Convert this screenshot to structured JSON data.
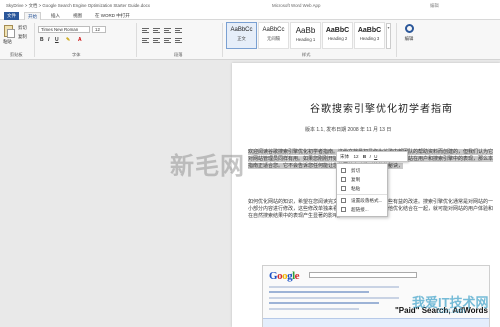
{
  "titlebar": {
    "breadcrumb": "SkyDrive > 文档 > Google Search Engine Optimization Starter Guide.docx",
    "app_title": "Microsoft Word Web App",
    "edit_flag": "编辑"
  },
  "tabs": [
    {
      "label": "文件"
    },
    {
      "label": "开始"
    },
    {
      "label": "插入"
    },
    {
      "label": "视图"
    },
    {
      "label": "在 WORD 中打开"
    }
  ],
  "ribbon": {
    "clipboard": {
      "paste": "粘贴",
      "cut": "剪切",
      "copy": "复制",
      "group_label": "剪贴板"
    },
    "font": {
      "name": "Times New Roman",
      "size": "12",
      "group_label": "字体",
      "bold": "B",
      "italic": "I",
      "underline": "U"
    },
    "paragraph": {
      "group_label": "段落"
    },
    "styles": {
      "group_label": "样式",
      "items": [
        {
          "sample": "AaBbCc",
          "name": "正文"
        },
        {
          "sample": "AaBbCc",
          "name": "无间隔"
        },
        {
          "sample": "AaBb",
          "name": "Heading 1"
        },
        {
          "sample": "AaBbC",
          "name": "Heading 2"
        },
        {
          "sample": "AaBbC",
          "name": "Heading 3"
        }
      ]
    },
    "editing": {
      "label": "编辑"
    }
  },
  "document": {
    "title": "谷歌搜索引擎优化初学者指南",
    "meta": "版本 1.1, 发布日期 2008 年 11 月 13 日",
    "paragraph1": "欢迎阅读谷歌搜索引擎优化初学者指南。这份文档最初是作为谷歌内部团队的帮助资料而创建的，但我们认为它对网站管理员同样有用。如果您刚刚开始接触搜索引擎优化，希望提升网站在用户和搜索引擎中的表现，那么本指南正适合您。它不会告诉您任何能让您的网站自动排到首位的秘诀，",
    "paragraph2": "如何优化网站的知识，希望在您阅读完文档之后能对网站进行一些有益的改进。搜索引擎优化通常是对网站的一小部分内容进行修改，这些修改单独来看似乎并不起眼，但与其他优化结合在一起，就可能对网站的用户体验和在自然搜索结果中的表现产生显著的影响。"
  },
  "minibar": {
    "font": "宋体",
    "size": "12",
    "bold": "B",
    "italic": "I",
    "underline": "U"
  },
  "context_menu": {
    "items": [
      {
        "label": "剪切"
      },
      {
        "label": "复制"
      },
      {
        "label": "粘贴"
      },
      {
        "label": "设置段落格式..."
      },
      {
        "label": "超链接..."
      }
    ]
  },
  "figure": {
    "logo_letters": [
      "G",
      "o",
      "o",
      "g",
      "l",
      "e"
    ],
    "caption": "\"Paid\" Search, AdWords"
  },
  "watermarks": {
    "left": "新毛网",
    "right": "我爱IT技术网",
    "right_sub": "52ct.com"
  }
}
